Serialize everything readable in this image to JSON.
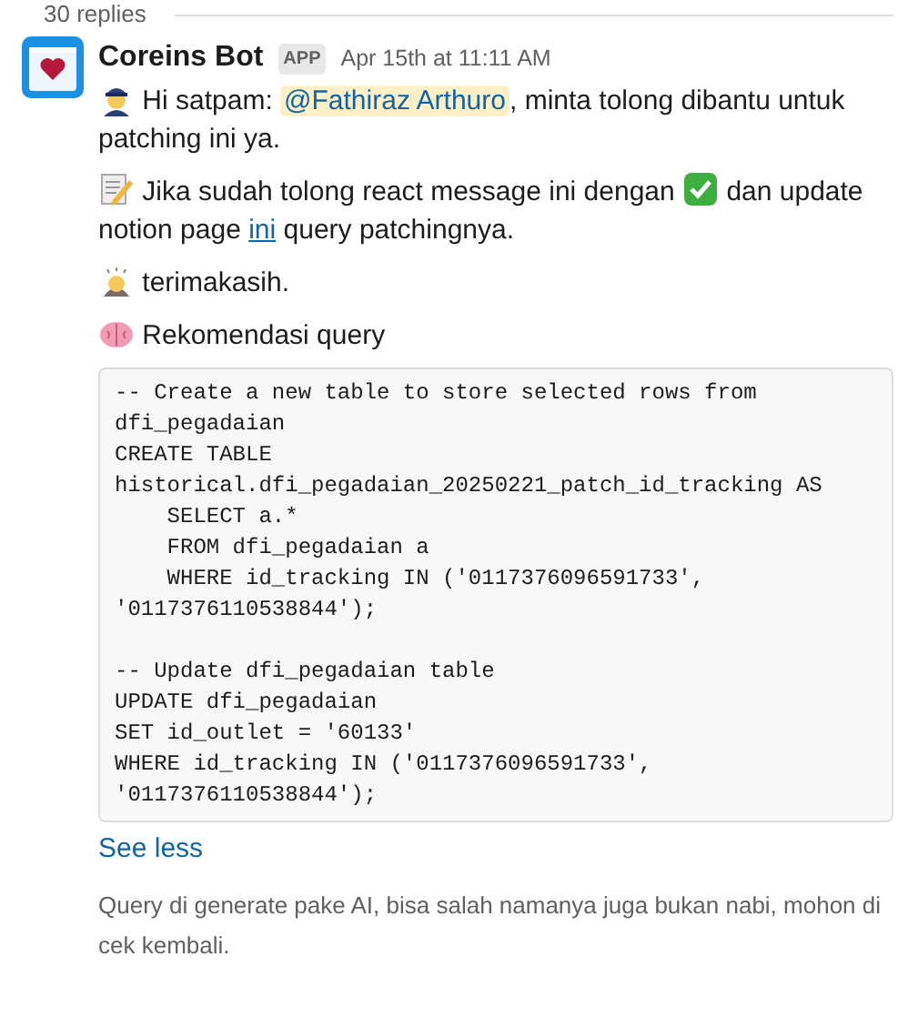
{
  "thread": {
    "replies_label": "30 replies"
  },
  "message": {
    "author": "Coreins Bot",
    "badge": "APP",
    "time": "Apr 15th at 11:11 AM",
    "paragraphs": [
      {
        "parts": [
          {
            "kind": "text",
            "text": "Hi satpam: "
          },
          {
            "kind": "mention",
            "text": "@Fathiraz Arthuro"
          },
          {
            "kind": "text",
            "text": ", minta tolong dibantu untuk patching ini ya."
          }
        ]
      },
      {
        "parts": [
          {
            "kind": "text",
            "text": "Jika sudah tolong react message ini dengan "
          },
          {
            "kind": "emoji"
          },
          {
            "kind": "text",
            "text": " dan update notion page "
          },
          {
            "kind": "link",
            "text": "ini"
          },
          {
            "kind": "text",
            "text": " query patchingnya."
          }
        ]
      },
      {
        "parts": [
          {
            "kind": "text",
            "text": "terimakasih."
          }
        ]
      },
      {
        "parts": [
          {
            "kind": "text",
            "text": "Rekomendasi query"
          }
        ]
      }
    ],
    "code_lines": [
      [
        "-- Create a new table to store selected rows from",
        "dfi_pegadaian",
        "CREATE TABLE",
        "historical.dfi_pegadaian_20250221_patch_id_tracking AS",
        "    SELECT a.*",
        "    FROM dfi_pegadaian a",
        "    WHERE id_tracking IN ('0117376096591733',",
        "'0117376110538844');"
      ],
      [
        "-- Update dfi_pegadaian table",
        "UPDATE dfi_pegadaian",
        "SET id_outlet = '60133'",
        "WHERE id_tracking IN ('0117376096591733',",
        "'0117376110538844');"
      ]
    ],
    "toggle": "See less",
    "footnote": "Query di generate pake AI, bisa salah namanya juga bukan nabi, mohon di cek kembali."
  }
}
